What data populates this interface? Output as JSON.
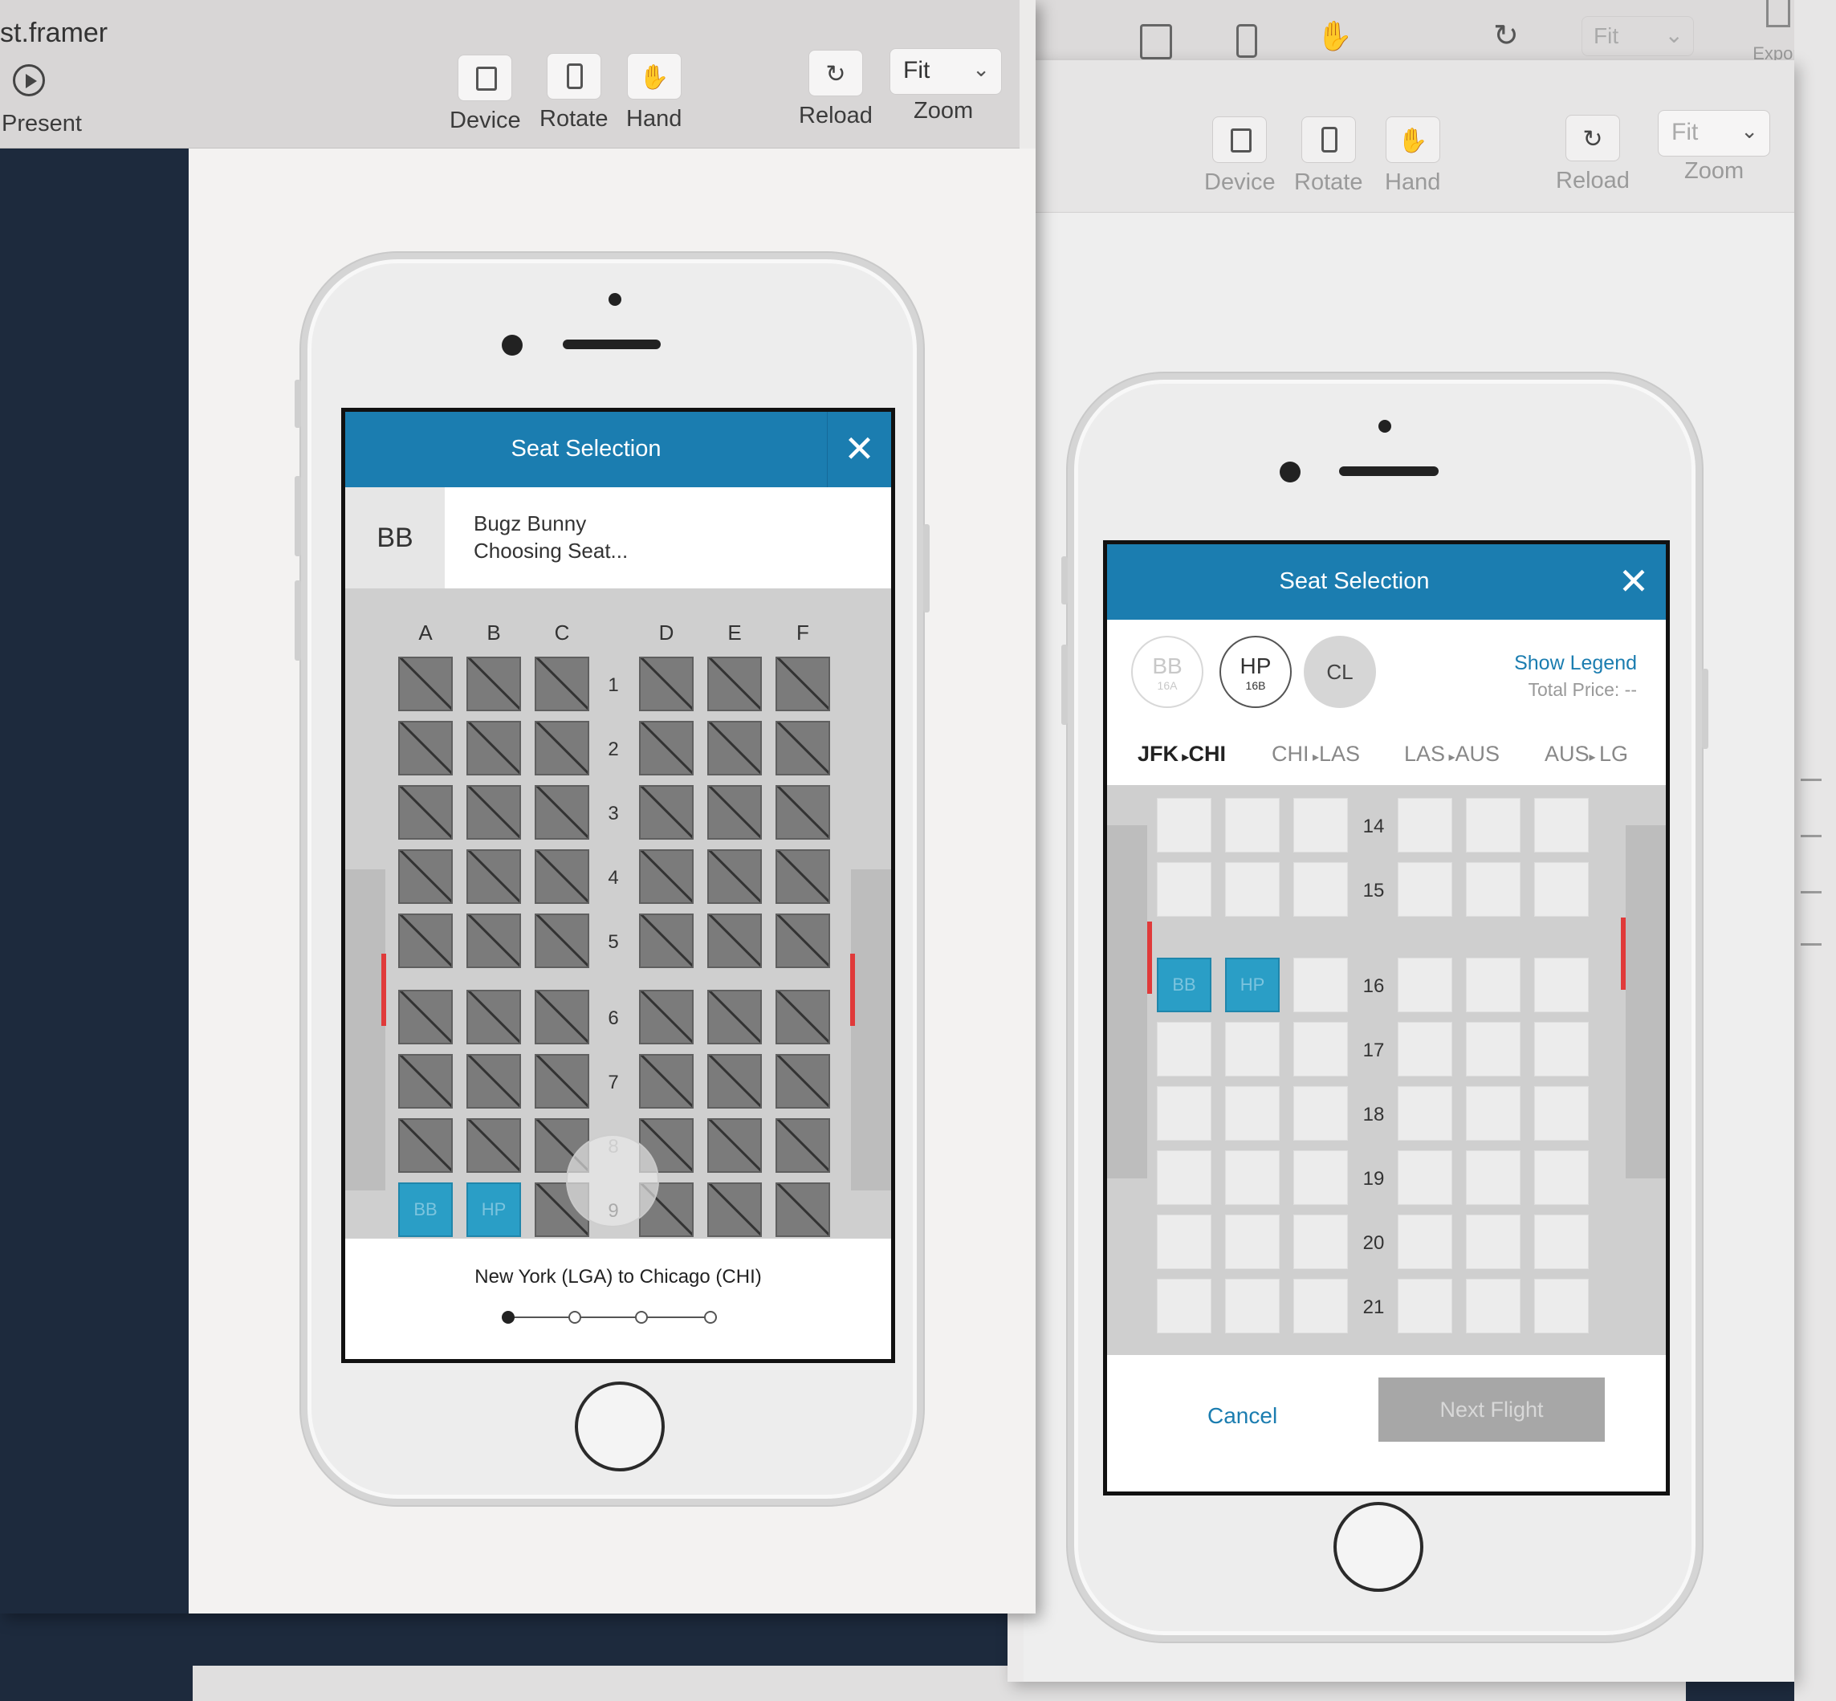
{
  "left_window": {
    "doc_title": "st.framer",
    "present_label": "Present",
    "toolbar": {
      "device": "Device",
      "rotate": "Rotate",
      "hand": "Hand",
      "reload": "Reload",
      "zoom_label": "Zoom",
      "zoom_value": "Fit"
    },
    "screen": {
      "title": "Seat Selection",
      "close_glyph": "✕",
      "passenger_initials": "BB",
      "passenger_name": "Bugz Bunny",
      "passenger_status": "Choosing Seat...",
      "columns": [
        "A",
        "B",
        "C",
        "D",
        "E",
        "F"
      ],
      "rows": [
        "1",
        "2",
        "3",
        "4",
        "5",
        "6",
        "7",
        "8",
        "9"
      ],
      "selected_seats": [
        "BB",
        "HP"
      ],
      "route": "New York (LGA) to Chicago (CHI)",
      "progress": {
        "total_steps": 4,
        "current_step": 1
      }
    }
  },
  "right_window": {
    "toolbar": {
      "device": "Device",
      "rotate": "Rotate",
      "hand": "Hand",
      "reload": "Reload",
      "zoom_label": "Zoom",
      "zoom_value": "Fit"
    },
    "back_toolbar": {
      "zoom_value": "Fit",
      "export_label": "Export"
    },
    "screen": {
      "title": "Seat Selection",
      "close_glyph": "✕",
      "passengers": [
        {
          "initials": "BB",
          "seat": "16A"
        },
        {
          "initials": "HP",
          "seat": "16B"
        },
        {
          "initials": "CL",
          "seat": ""
        }
      ],
      "show_legend": "Show Legend",
      "total_price": "Total Price: --",
      "legs": [
        {
          "from": "JFK",
          "to": "CHI"
        },
        {
          "from": "CHI",
          "to": "LAS"
        },
        {
          "from": "LAS",
          "to": "AUS"
        },
        {
          "from": "AUS",
          "to": "LG"
        }
      ],
      "rows": [
        "14",
        "15",
        "16",
        "17",
        "18",
        "19",
        "20",
        "21"
      ],
      "selected_seats": [
        "BB",
        "HP"
      ],
      "cancel": "Cancel",
      "next": "Next Flight"
    }
  },
  "colors": {
    "header_blue": "#1b7db0",
    "selected_seat": "#2a9ec6",
    "occupied_seat": "#7b7b7b",
    "exit_red": "#e03a3a"
  }
}
